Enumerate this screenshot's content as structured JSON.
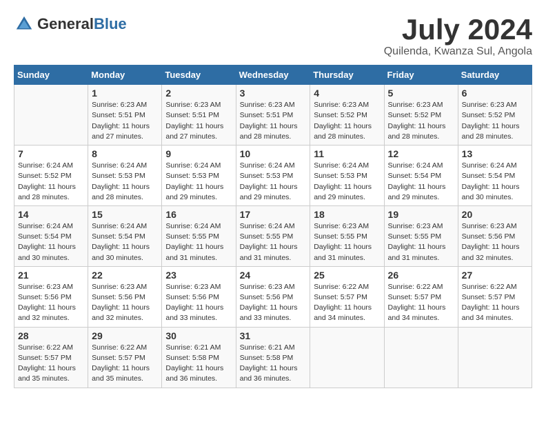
{
  "logo": {
    "general": "General",
    "blue": "Blue"
  },
  "title": "July 2024",
  "subtitle": "Quilenda, Kwanza Sul, Angola",
  "calendar": {
    "headers": [
      "Sunday",
      "Monday",
      "Tuesday",
      "Wednesday",
      "Thursday",
      "Friday",
      "Saturday"
    ],
    "rows": [
      [
        {
          "day": "",
          "detail": ""
        },
        {
          "day": "1",
          "detail": "Sunrise: 6:23 AM\nSunset: 5:51 PM\nDaylight: 11 hours and 27 minutes."
        },
        {
          "day": "2",
          "detail": "Sunrise: 6:23 AM\nSunset: 5:51 PM\nDaylight: 11 hours and 27 minutes."
        },
        {
          "day": "3",
          "detail": "Sunrise: 6:23 AM\nSunset: 5:51 PM\nDaylight: 11 hours and 28 minutes."
        },
        {
          "day": "4",
          "detail": "Sunrise: 6:23 AM\nSunset: 5:52 PM\nDaylight: 11 hours and 28 minutes."
        },
        {
          "day": "5",
          "detail": "Sunrise: 6:23 AM\nSunset: 5:52 PM\nDaylight: 11 hours and 28 minutes."
        },
        {
          "day": "6",
          "detail": "Sunrise: 6:23 AM\nSunset: 5:52 PM\nDaylight: 11 hours and 28 minutes."
        }
      ],
      [
        {
          "day": "7",
          "detail": "Sunrise: 6:24 AM\nSunset: 5:52 PM\nDaylight: 11 hours and 28 minutes."
        },
        {
          "day": "8",
          "detail": "Sunrise: 6:24 AM\nSunset: 5:53 PM\nDaylight: 11 hours and 28 minutes."
        },
        {
          "day": "9",
          "detail": "Sunrise: 6:24 AM\nSunset: 5:53 PM\nDaylight: 11 hours and 29 minutes."
        },
        {
          "day": "10",
          "detail": "Sunrise: 6:24 AM\nSunset: 5:53 PM\nDaylight: 11 hours and 29 minutes."
        },
        {
          "day": "11",
          "detail": "Sunrise: 6:24 AM\nSunset: 5:53 PM\nDaylight: 11 hours and 29 minutes."
        },
        {
          "day": "12",
          "detail": "Sunrise: 6:24 AM\nSunset: 5:54 PM\nDaylight: 11 hours and 29 minutes."
        },
        {
          "day": "13",
          "detail": "Sunrise: 6:24 AM\nSunset: 5:54 PM\nDaylight: 11 hours and 30 minutes."
        }
      ],
      [
        {
          "day": "14",
          "detail": "Sunrise: 6:24 AM\nSunset: 5:54 PM\nDaylight: 11 hours and 30 minutes."
        },
        {
          "day": "15",
          "detail": "Sunrise: 6:24 AM\nSunset: 5:54 PM\nDaylight: 11 hours and 30 minutes."
        },
        {
          "day": "16",
          "detail": "Sunrise: 6:24 AM\nSunset: 5:55 PM\nDaylight: 11 hours and 31 minutes."
        },
        {
          "day": "17",
          "detail": "Sunrise: 6:24 AM\nSunset: 5:55 PM\nDaylight: 11 hours and 31 minutes."
        },
        {
          "day": "18",
          "detail": "Sunrise: 6:23 AM\nSunset: 5:55 PM\nDaylight: 11 hours and 31 minutes."
        },
        {
          "day": "19",
          "detail": "Sunrise: 6:23 AM\nSunset: 5:55 PM\nDaylight: 11 hours and 31 minutes."
        },
        {
          "day": "20",
          "detail": "Sunrise: 6:23 AM\nSunset: 5:56 PM\nDaylight: 11 hours and 32 minutes."
        }
      ],
      [
        {
          "day": "21",
          "detail": "Sunrise: 6:23 AM\nSunset: 5:56 PM\nDaylight: 11 hours and 32 minutes."
        },
        {
          "day": "22",
          "detail": "Sunrise: 6:23 AM\nSunset: 5:56 PM\nDaylight: 11 hours and 32 minutes."
        },
        {
          "day": "23",
          "detail": "Sunrise: 6:23 AM\nSunset: 5:56 PM\nDaylight: 11 hours and 33 minutes."
        },
        {
          "day": "24",
          "detail": "Sunrise: 6:23 AM\nSunset: 5:56 PM\nDaylight: 11 hours and 33 minutes."
        },
        {
          "day": "25",
          "detail": "Sunrise: 6:22 AM\nSunset: 5:57 PM\nDaylight: 11 hours and 34 minutes."
        },
        {
          "day": "26",
          "detail": "Sunrise: 6:22 AM\nSunset: 5:57 PM\nDaylight: 11 hours and 34 minutes."
        },
        {
          "day": "27",
          "detail": "Sunrise: 6:22 AM\nSunset: 5:57 PM\nDaylight: 11 hours and 34 minutes."
        }
      ],
      [
        {
          "day": "28",
          "detail": "Sunrise: 6:22 AM\nSunset: 5:57 PM\nDaylight: 11 hours and 35 minutes."
        },
        {
          "day": "29",
          "detail": "Sunrise: 6:22 AM\nSunset: 5:57 PM\nDaylight: 11 hours and 35 minutes."
        },
        {
          "day": "30",
          "detail": "Sunrise: 6:21 AM\nSunset: 5:58 PM\nDaylight: 11 hours and 36 minutes."
        },
        {
          "day": "31",
          "detail": "Sunrise: 6:21 AM\nSunset: 5:58 PM\nDaylight: 11 hours and 36 minutes."
        },
        {
          "day": "",
          "detail": ""
        },
        {
          "day": "",
          "detail": ""
        },
        {
          "day": "",
          "detail": ""
        }
      ]
    ]
  }
}
